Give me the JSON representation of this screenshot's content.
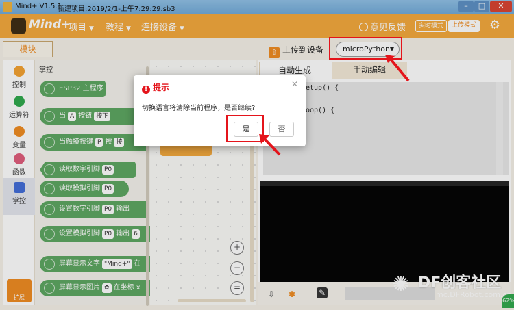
{
  "titlebar": {
    "app": "Mind+ V1.5.1",
    "file": "新建项目:2019/2/1-上午7:29:29.sb3"
  },
  "menubar": {
    "logo": "Mind+",
    "menus": [
      "项目",
      "教程",
      "连接设备"
    ],
    "feedback": "意见反馈",
    "realtime_mode": "实时模式",
    "upload_mode": "上传模式"
  },
  "toolbar": {
    "blocks_tab": "模块",
    "upload_label": "上传到设备",
    "device_selected": "microPython"
  },
  "categories": [
    {
      "label": "控制",
      "color": "#f4a12f"
    },
    {
      "label": "运算符",
      "color": "#2ca84b"
    },
    {
      "label": "变量",
      "color": "#f08a1e"
    },
    {
      "label": "函数",
      "color": "#e05a7a"
    },
    {
      "label": "掌控",
      "color": "#3f6ad8"
    }
  ],
  "extension_label": "扩展",
  "palette": {
    "heading": "掌控",
    "blocks": [
      {
        "text": "ESP32 主程序"
      },
      {
        "prefix": "当",
        "d1": "A",
        "mid": "按钮",
        "d2": "按下"
      },
      {
        "prefix": "当触摸按键",
        "d1": "P",
        "mid": "被",
        "d2": "按"
      },
      {
        "prefix": "读取数字引脚",
        "d1": "P0"
      },
      {
        "prefix": "读取模拟引脚",
        "d1": "P0"
      },
      {
        "prefix": "设置数字引脚",
        "d1": "P0",
        "mid": "输出"
      },
      {
        "prefix": "设置模拟引脚",
        "d1": "P0",
        "mid": "输出",
        "d2": "6"
      },
      {
        "prefix": "屏幕显示文字",
        "d1": "\"Mind+\"",
        "mid": "在"
      },
      {
        "prefix": "屏幕显示图片",
        "mid": "在坐标 x"
      }
    ]
  },
  "editor": {
    "tab_auto": "自动生成",
    "tab_manual": "手动编辑",
    "code_lines": [
      "etup() {",
      "oop() {"
    ]
  },
  "dialog": {
    "title": "提示",
    "message": "切换语言将清除当前程序，是否继续?",
    "confirm": "是",
    "cancel": "否"
  },
  "watermark": {
    "brand": "DF创客社区",
    "url": "mc.DFRobot.com.cn",
    "percent": "62%"
  }
}
